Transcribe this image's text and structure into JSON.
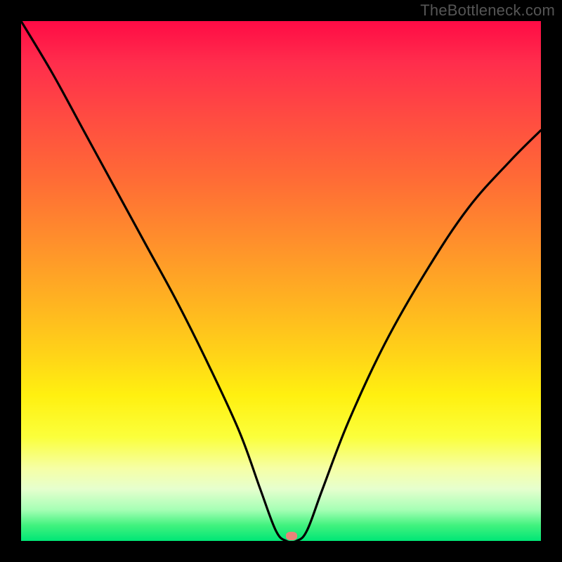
{
  "attribution": "TheBottleneck.com",
  "chart_data": {
    "type": "line",
    "title": "",
    "xlabel": "",
    "ylabel": "",
    "xlim": [
      0,
      100
    ],
    "ylim": [
      0,
      100
    ],
    "grid": false,
    "legend": false,
    "series": [
      {
        "name": "bottleneck-curve",
        "x": [
          0,
          6,
          12,
          18,
          24,
          30,
          36,
          42,
          46,
          49,
          51,
          53,
          55,
          58,
          63,
          70,
          78,
          86,
          94,
          100
        ],
        "values": [
          100,
          90,
          79,
          68,
          57,
          46,
          34,
          21,
          10,
          2,
          0,
          0,
          2,
          10,
          23,
          38,
          52,
          64,
          73,
          79
        ]
      }
    ],
    "annotations": [
      {
        "name": "min-marker",
        "x": 52,
        "y": 1
      }
    ],
    "background_gradient": {
      "orientation": "vertical",
      "stops": [
        {
          "pos": 0,
          "color": "#ff0b45"
        },
        {
          "pos": 18,
          "color": "#ff4a42"
        },
        {
          "pos": 42,
          "color": "#ff8e2c"
        },
        {
          "pos": 64,
          "color": "#ffd318"
        },
        {
          "pos": 80,
          "color": "#fbff3b"
        },
        {
          "pos": 94,
          "color": "#a6ffb5"
        },
        {
          "pos": 100,
          "color": "#00e676"
        }
      ]
    }
  }
}
